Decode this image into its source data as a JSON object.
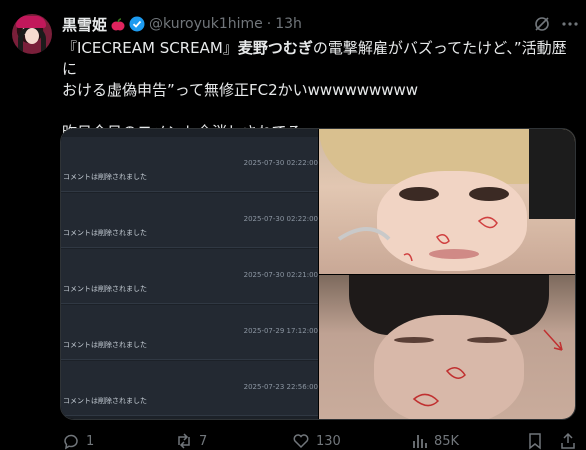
{
  "post": {
    "display_name": "黒雪姫",
    "handle": "@kuroyuk1hime",
    "separator": "·",
    "time": "13h",
    "text_line_1": "『ICECREAM SCREAM』",
    "text_name": "麦野つむぎ",
    "text_line_1_rest": "の電撃解雇がバズってたけど、”活動歴に",
    "text_line_2": "おける虚偽申告”って無修正FC2かいwwwwwwwww",
    "text_line_3": "昨日今日のコメント全消しされてるwwwwww"
  },
  "media": {
    "comments": [
      {
        "timestamp": "2025-07-30 02:22:00",
        "text": "コメントは削除されました"
      },
      {
        "timestamp": "2025-07-30 02:22:00",
        "text": "コメントは削除されました"
      },
      {
        "timestamp": "2025-07-30 02:21:00",
        "text": "コメントは削除されました"
      },
      {
        "timestamp": "2025-07-29 17:12:00",
        "text": "コメントは削除されました"
      },
      {
        "timestamp": "2025-07-23 22:56:00",
        "text": "コメントは削除されました"
      }
    ]
  },
  "actions": {
    "replies": "1",
    "reposts": "7",
    "likes": "130",
    "views": "85K"
  },
  "icons": {
    "apple": "apple-icon",
    "verified": "verified-badge-icon",
    "grok": "grok-icon",
    "more": "more-icon",
    "reply": "reply-icon",
    "repost": "repost-icon",
    "like": "heart-icon",
    "views": "analytics-icon",
    "bookmark": "bookmark-icon",
    "share": "share-icon"
  },
  "colors": {
    "background": "#000000",
    "text": "#e7e9ea",
    "muted": "#71767b",
    "verified": "#1d9bf0"
  }
}
